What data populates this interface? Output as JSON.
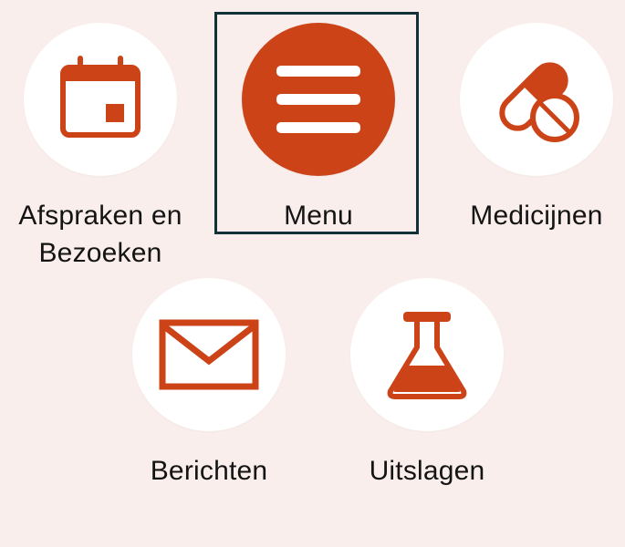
{
  "colors": {
    "background": "#f9eeeb",
    "accent": "#cc4318",
    "circle": "#ffffff",
    "focus_border": "#123238",
    "text": "#141414"
  },
  "tiles": [
    {
      "id": "appointments",
      "label": "Afspraken en Bezoeken",
      "icon": "calendar-icon"
    },
    {
      "id": "menu",
      "label": "Menu",
      "icon": "hamburger-menu-icon",
      "selected": true
    },
    {
      "id": "medicines",
      "label": "Medicijnen",
      "icon": "pill-capsule-icon"
    },
    {
      "id": "messages",
      "label": "Berichten",
      "icon": "envelope-icon"
    },
    {
      "id": "results",
      "label": "Uitslagen",
      "icon": "lab-flask-icon"
    }
  ]
}
